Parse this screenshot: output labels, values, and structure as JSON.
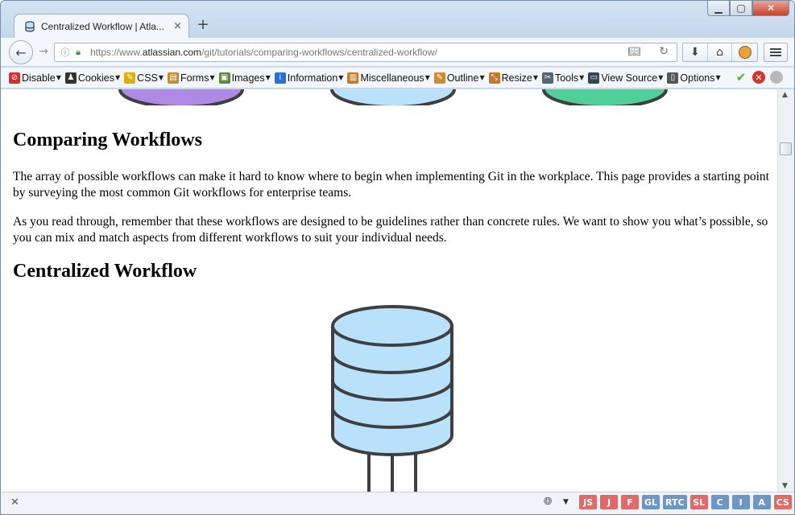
{
  "browser": {
    "tab_title": "Centralized Workflow | Atla...",
    "tab_close": "×",
    "new_tab": "+",
    "url_scheme": "https://www.",
    "url_host": "atlassian.com",
    "url_path": "/git/tutorials/comparing-workflows/centralized-workflow/"
  },
  "dev_toolbar": {
    "items": [
      {
        "label": "Disable",
        "icon": "disable-icon",
        "color": "#d32f2f"
      },
      {
        "label": "Cookies",
        "icon": "cookies-icon",
        "color": "#333333"
      },
      {
        "label": "CSS",
        "icon": "css-icon",
        "color": "#e0b000"
      },
      {
        "label": "Forms",
        "icon": "forms-icon",
        "color": "#c98a2c"
      },
      {
        "label": "Images",
        "icon": "images-icon",
        "color": "#5b8a3a"
      },
      {
        "label": "Information",
        "icon": "information-icon",
        "color": "#2a6fd6"
      },
      {
        "label": "Miscellaneous",
        "icon": "miscellaneous-icon",
        "color": "#c8782a"
      },
      {
        "label": "Outline",
        "icon": "outline-icon",
        "color": "#d08a2c"
      },
      {
        "label": "Resize",
        "icon": "resize-icon",
        "color": "#c8782a"
      },
      {
        "label": "Tools",
        "icon": "tools-icon",
        "color": "#556677"
      },
      {
        "label": "View Source",
        "icon": "view-source-icon",
        "color": "#334455"
      },
      {
        "label": "Options",
        "icon": "options-icon",
        "color": "#555555"
      }
    ]
  },
  "content": {
    "h_comparing": "Comparing Workflows",
    "p1": "The array of possible workflows can make it hard to know where to begin when implementing Git in the workplace. This page provides a starting point by surveying the most common Git workflows for enterprise teams.",
    "p2": "As you read through, remember that these workflows are designed to be guidelines rather than concrete rules. We want to show you what’s possible, so you can mix and match aspects from different workflows to suit your individual needs.",
    "h_centralized": "Centralized Workflow"
  },
  "colors": {
    "repo_fill": "#b9e1fb",
    "purple": "#b089e6",
    "green": "#4fcf99",
    "stroke": "#3f3f3f"
  },
  "status_badges": [
    {
      "label": "JS",
      "color": "#e06a6a"
    },
    {
      "label": "J",
      "color": "#e06a6a"
    },
    {
      "label": "F",
      "color": "#e06a6a"
    },
    {
      "label": "GL",
      "color": "#6d95c6"
    },
    {
      "label": "RTC",
      "color": "#6d95c6"
    },
    {
      "label": "SL",
      "color": "#e06a6a"
    },
    {
      "label": "C",
      "color": "#6d95c6"
    },
    {
      "label": "I",
      "color": "#6d95c6"
    },
    {
      "label": "A",
      "color": "#6d95c6"
    },
    {
      "label": "CS",
      "color": "#e06a6a"
    }
  ]
}
